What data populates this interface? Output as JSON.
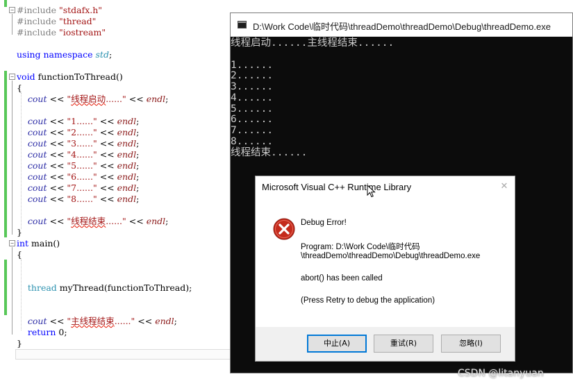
{
  "editor": {
    "lines": [
      {
        "segments": [
          {
            "t": "#include ",
            "c": "pp"
          },
          {
            "t": "\"stdafx.h\"",
            "c": "str"
          }
        ]
      },
      {
        "segments": [
          {
            "t": "#include ",
            "c": "pp"
          },
          {
            "t": "\"thread\"",
            "c": "str"
          }
        ]
      },
      {
        "segments": [
          {
            "t": "#include ",
            "c": "pp"
          },
          {
            "t": "\"iostream\"",
            "c": "str"
          }
        ]
      },
      {
        "segments": []
      },
      {
        "segments": [
          {
            "t": "using",
            "c": "kw"
          },
          {
            "t": " "
          },
          {
            "t": "namespace",
            "c": "kw"
          },
          {
            "t": " "
          },
          {
            "t": "std",
            "c": "ns"
          },
          {
            "t": ";"
          }
        ]
      },
      {
        "segments": []
      },
      {
        "segments": [
          {
            "t": "void",
            "c": "kw"
          },
          {
            "t": " functionToThread()"
          }
        ]
      },
      {
        "segments": [
          {
            "t": "{"
          }
        ]
      },
      {
        "segments": [
          {
            "t": "    "
          },
          {
            "t": "cout",
            "c": "io"
          },
          {
            "t": " << "
          },
          {
            "t": "\"",
            "c": "str"
          },
          {
            "t": "线程启动",
            "c": "str err"
          },
          {
            "t": "......\"",
            "c": "str"
          },
          {
            "t": " << "
          },
          {
            "t": "endl",
            "c": "io2"
          },
          {
            "t": ";"
          }
        ]
      },
      {
        "segments": []
      },
      {
        "segments": [
          {
            "t": "    "
          },
          {
            "t": "cout",
            "c": "io"
          },
          {
            "t": " << "
          },
          {
            "t": "\"1......\"",
            "c": "str"
          },
          {
            "t": " << "
          },
          {
            "t": "endl",
            "c": "io2"
          },
          {
            "t": ";"
          }
        ]
      },
      {
        "segments": [
          {
            "t": "    "
          },
          {
            "t": "cout",
            "c": "io"
          },
          {
            "t": " << "
          },
          {
            "t": "\"2......\"",
            "c": "str"
          },
          {
            "t": " << "
          },
          {
            "t": "endl",
            "c": "io2"
          },
          {
            "t": ";"
          }
        ]
      },
      {
        "segments": [
          {
            "t": "    "
          },
          {
            "t": "cout",
            "c": "io"
          },
          {
            "t": " << "
          },
          {
            "t": "\"3......\"",
            "c": "str"
          },
          {
            "t": " << "
          },
          {
            "t": "endl",
            "c": "io2"
          },
          {
            "t": ";"
          }
        ]
      },
      {
        "segments": [
          {
            "t": "    "
          },
          {
            "t": "cout",
            "c": "io"
          },
          {
            "t": " << "
          },
          {
            "t": "\"4......\"",
            "c": "str"
          },
          {
            "t": " << "
          },
          {
            "t": "endl",
            "c": "io2"
          },
          {
            "t": ";"
          }
        ]
      },
      {
        "segments": [
          {
            "t": "    "
          },
          {
            "t": "cout",
            "c": "io"
          },
          {
            "t": " << "
          },
          {
            "t": "\"5......\"",
            "c": "str"
          },
          {
            "t": " << "
          },
          {
            "t": "endl",
            "c": "io2"
          },
          {
            "t": ";"
          }
        ]
      },
      {
        "segments": [
          {
            "t": "    "
          },
          {
            "t": "cout",
            "c": "io"
          },
          {
            "t": " << "
          },
          {
            "t": "\"6......\"",
            "c": "str"
          },
          {
            "t": " << "
          },
          {
            "t": "endl",
            "c": "io2"
          },
          {
            "t": ";"
          }
        ]
      },
      {
        "segments": [
          {
            "t": "    "
          },
          {
            "t": "cout",
            "c": "io"
          },
          {
            "t": " << "
          },
          {
            "t": "\"7......\"",
            "c": "str"
          },
          {
            "t": " << "
          },
          {
            "t": "endl",
            "c": "io2"
          },
          {
            "t": ";"
          }
        ]
      },
      {
        "segments": [
          {
            "t": "    "
          },
          {
            "t": "cout",
            "c": "io"
          },
          {
            "t": " << "
          },
          {
            "t": "\"8......\"",
            "c": "str"
          },
          {
            "t": " << "
          },
          {
            "t": "endl",
            "c": "io2"
          },
          {
            "t": ";"
          }
        ]
      },
      {
        "segments": []
      },
      {
        "segments": [
          {
            "t": "    "
          },
          {
            "t": "cout",
            "c": "io"
          },
          {
            "t": " << "
          },
          {
            "t": "\"",
            "c": "str"
          },
          {
            "t": "线程结束",
            "c": "str err"
          },
          {
            "t": "......\"",
            "c": "str"
          },
          {
            "t": " << "
          },
          {
            "t": "endl",
            "c": "io2"
          },
          {
            "t": ";"
          }
        ]
      },
      {
        "segments": [
          {
            "t": "}"
          }
        ]
      },
      {
        "segments": [
          {
            "t": "int",
            "c": "kw"
          },
          {
            "t": " main()"
          }
        ]
      },
      {
        "segments": [
          {
            "t": "{"
          }
        ]
      },
      {
        "segments": []
      },
      {
        "segments": []
      },
      {
        "segments": [
          {
            "t": "    "
          },
          {
            "t": "thread",
            "c": "ty"
          },
          {
            "t": " myThread(functionToThread);"
          }
        ]
      },
      {
        "segments": []
      },
      {
        "segments": []
      },
      {
        "segments": [
          {
            "t": "    "
          },
          {
            "t": "cout",
            "c": "io"
          },
          {
            "t": " << "
          },
          {
            "t": "\"",
            "c": "str"
          },
          {
            "t": "主线程结束",
            "c": "str err"
          },
          {
            "t": "......\"",
            "c": "str"
          },
          {
            "t": " << "
          },
          {
            "t": "endl",
            "c": "io2"
          },
          {
            "t": ";"
          }
        ]
      },
      {
        "segments": [
          {
            "t": "    "
          },
          {
            "t": "return",
            "c": "kw"
          },
          {
            "t": " 0;"
          }
        ]
      },
      {
        "segments": [
          {
            "t": "}"
          }
        ]
      }
    ]
  },
  "console": {
    "title": "D:\\Work Code\\临时代码\\threadDemo\\threadDemo\\Debug\\threadDemo.exe",
    "lines": [
      "线程启动......主线程结束......",
      "",
      "1......",
      "2......",
      "3......",
      "4......",
      "5......",
      "6......",
      "7......",
      "8......",
      "线程结束......"
    ]
  },
  "dialog": {
    "title": "Microsoft Visual C++ Runtime Library",
    "close_glyph": "✕",
    "heading": "Debug Error!",
    "program_line1": "Program: D:\\Work Code\\临时代码",
    "program_line2": "\\threadDemo\\threadDemo\\Debug\\threadDemo.exe",
    "message": "abort() has been called",
    "hint": "(Press Retry to debug the application)",
    "buttons": {
      "abort": "中止(A)",
      "retry": "重试(R)",
      "ignore": "忽略(I)"
    },
    "icon": "error-icon",
    "error_color": "#c42b1c"
  },
  "watermark": "CSDN @litanyuan"
}
